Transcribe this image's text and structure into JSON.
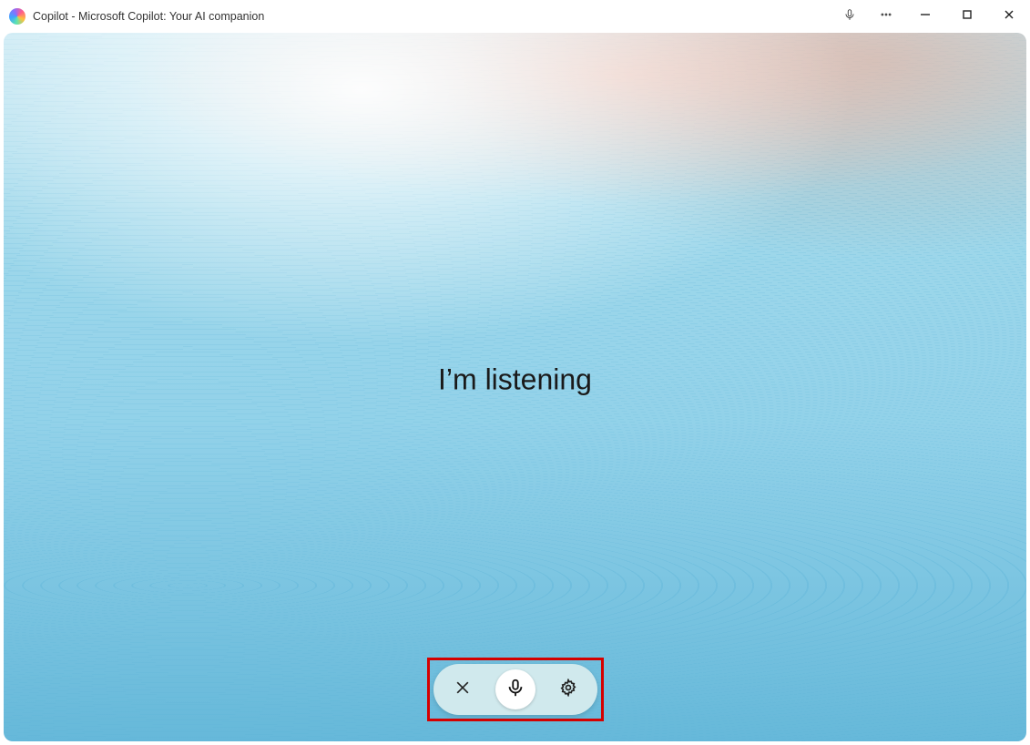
{
  "window": {
    "title": "Copilot - Microsoft Copilot: Your AI companion"
  },
  "titlebar_icons": {
    "mic": "microphone-icon",
    "more": "more-icon",
    "minimize": "minimize-icon",
    "maximize": "maximize-icon",
    "close": "close-icon"
  },
  "status_text": "I’m listening",
  "voice_controls": {
    "close_label": "Close voice mode",
    "mic_label": "Microphone",
    "settings_label": "Voice settings"
  },
  "highlight_color": "#d50000"
}
